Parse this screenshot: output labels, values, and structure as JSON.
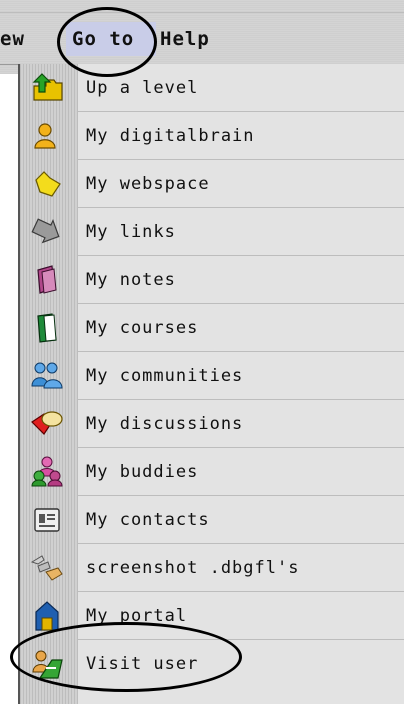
{
  "menubar": {
    "view_fragment": "ew",
    "goto_label": "Go to",
    "help_fragment": "Help"
  },
  "menu": {
    "items": [
      {
        "label": "Up a level",
        "icon": "up-level-icon"
      },
      {
        "label": "My digitalbrain",
        "icon": "digitalbrain-icon"
      },
      {
        "label": "My webspace",
        "icon": "webspace-folder-icon"
      },
      {
        "label": "My links",
        "icon": "links-arrow-icon"
      },
      {
        "label": "My notes",
        "icon": "notes-book-icon"
      },
      {
        "label": "My courses",
        "icon": "courses-book-icon"
      },
      {
        "label": "My communities",
        "icon": "communities-people-icon"
      },
      {
        "label": "My discussions",
        "icon": "discussions-bubbles-icon"
      },
      {
        "label": "My buddies",
        "icon": "buddies-people-icon"
      },
      {
        "label": "My contacts",
        "icon": "contacts-card-icon"
      },
      {
        "label": "screenshot .dbgfl's",
        "icon": "screenshot-file-icon"
      },
      {
        "label": "My portal",
        "icon": "portal-house-icon"
      },
      {
        "label": "Visit user",
        "icon": "visit-user-icon"
      }
    ]
  },
  "colors": {
    "menu_bg": "#e3e3e3",
    "menubar_bg": "#d2d2d2",
    "goto_highlight": "#c9cde8",
    "annotation": "#000000"
  }
}
